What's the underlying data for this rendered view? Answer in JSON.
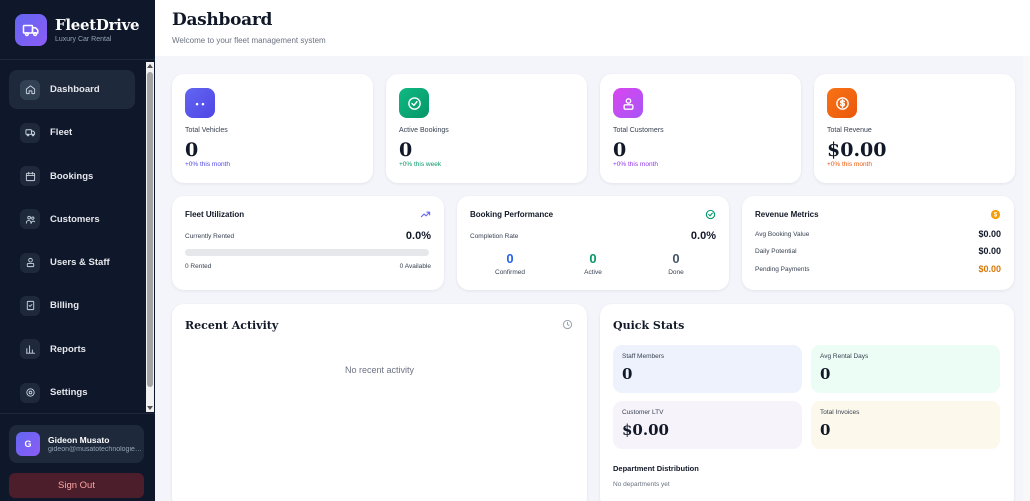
{
  "brand": {
    "name": "FleetDrive",
    "subtitle": "Luxury Car Rental"
  },
  "nav": [
    {
      "label": "Dashboard",
      "icon": "home-icon",
      "active": true
    },
    {
      "label": "Fleet",
      "icon": "truck-icon"
    },
    {
      "label": "Bookings",
      "icon": "calendar-icon"
    },
    {
      "label": "Customers",
      "icon": "users-icon"
    },
    {
      "label": "Users & Staff",
      "icon": "user-group-icon"
    },
    {
      "label": "Billing",
      "icon": "receipt-icon"
    },
    {
      "label": "Reports",
      "icon": "bar-chart-icon"
    },
    {
      "label": "Settings",
      "icon": "gear-icon"
    }
  ],
  "user": {
    "initial": "G",
    "name": "Gideon Musato",
    "email": "gideon@musatotechnologies.com"
  },
  "signout_label": "Sign Out",
  "header": {
    "title": "Dashboard",
    "subtitle": "Welcome to your fleet management system"
  },
  "stats": [
    {
      "label": "Total Vehicles",
      "value": "0",
      "change": "+0% this month",
      "color": "#4f46e5",
      "gradient": [
        "#6366f1",
        "#4f46e5"
      ],
      "icon": "car-icon"
    },
    {
      "label": "Active Bookings",
      "value": "0",
      "change": "+0% this week",
      "color": "#059669",
      "gradient": [
        "#10b981",
        "#059669"
      ],
      "icon": "check-circle-icon"
    },
    {
      "label": "Total Customers",
      "value": "0",
      "change": "+0% this month",
      "color": "#9333ea",
      "gradient": [
        "#d946ef",
        "#a855f7"
      ],
      "icon": "users-icon"
    },
    {
      "label": "Total Revenue",
      "value": "$0.00",
      "change": "+0% this month",
      "color": "#ea580c",
      "gradient": [
        "#f97316",
        "#ea580c"
      ],
      "icon": "dollar-icon"
    }
  ],
  "utilization": {
    "title": "Fleet Utilization",
    "row_label": "Currently Rented",
    "percent": "0.0%",
    "fill_fraction": 0,
    "rented": "0 Rented",
    "available": "0 Available"
  },
  "performance": {
    "title": "Booking Performance",
    "row_label": "Completion Rate",
    "percent": "0.0%",
    "items": [
      {
        "value": "0",
        "label": "Confirmed",
        "color": "#2563eb"
      },
      {
        "value": "0",
        "label": "Active",
        "color": "#059669"
      },
      {
        "value": "0",
        "label": "Done",
        "color": "#475569"
      }
    ]
  },
  "revenue": {
    "title": "Revenue Metrics",
    "rows": [
      {
        "label": "Avg Booking Value",
        "value": "$0.00",
        "color": "#111827"
      },
      {
        "label": "Daily Potential",
        "value": "$0.00",
        "color": "#111827"
      },
      {
        "label": "Pending Payments",
        "value": "$0.00",
        "color": "#d97706"
      }
    ]
  },
  "activity": {
    "title": "Recent Activity",
    "empty": "No recent activity"
  },
  "quick_stats": {
    "title": "Quick Stats",
    "boxes": [
      {
        "label": "Staff Members",
        "value": "0",
        "bg": "#eef2fd"
      },
      {
        "label": "Avg Rental Days",
        "value": "0",
        "bg": "#ecfdf5"
      },
      {
        "label": "Customer LTV",
        "value": "$0.00",
        "bg": "#f7f3fb"
      },
      {
        "label": "Total Invoices",
        "value": "0",
        "bg": "#fdf8ec"
      }
    ],
    "dept_title": "Department Distribution",
    "dept_empty": "No departments yet"
  }
}
